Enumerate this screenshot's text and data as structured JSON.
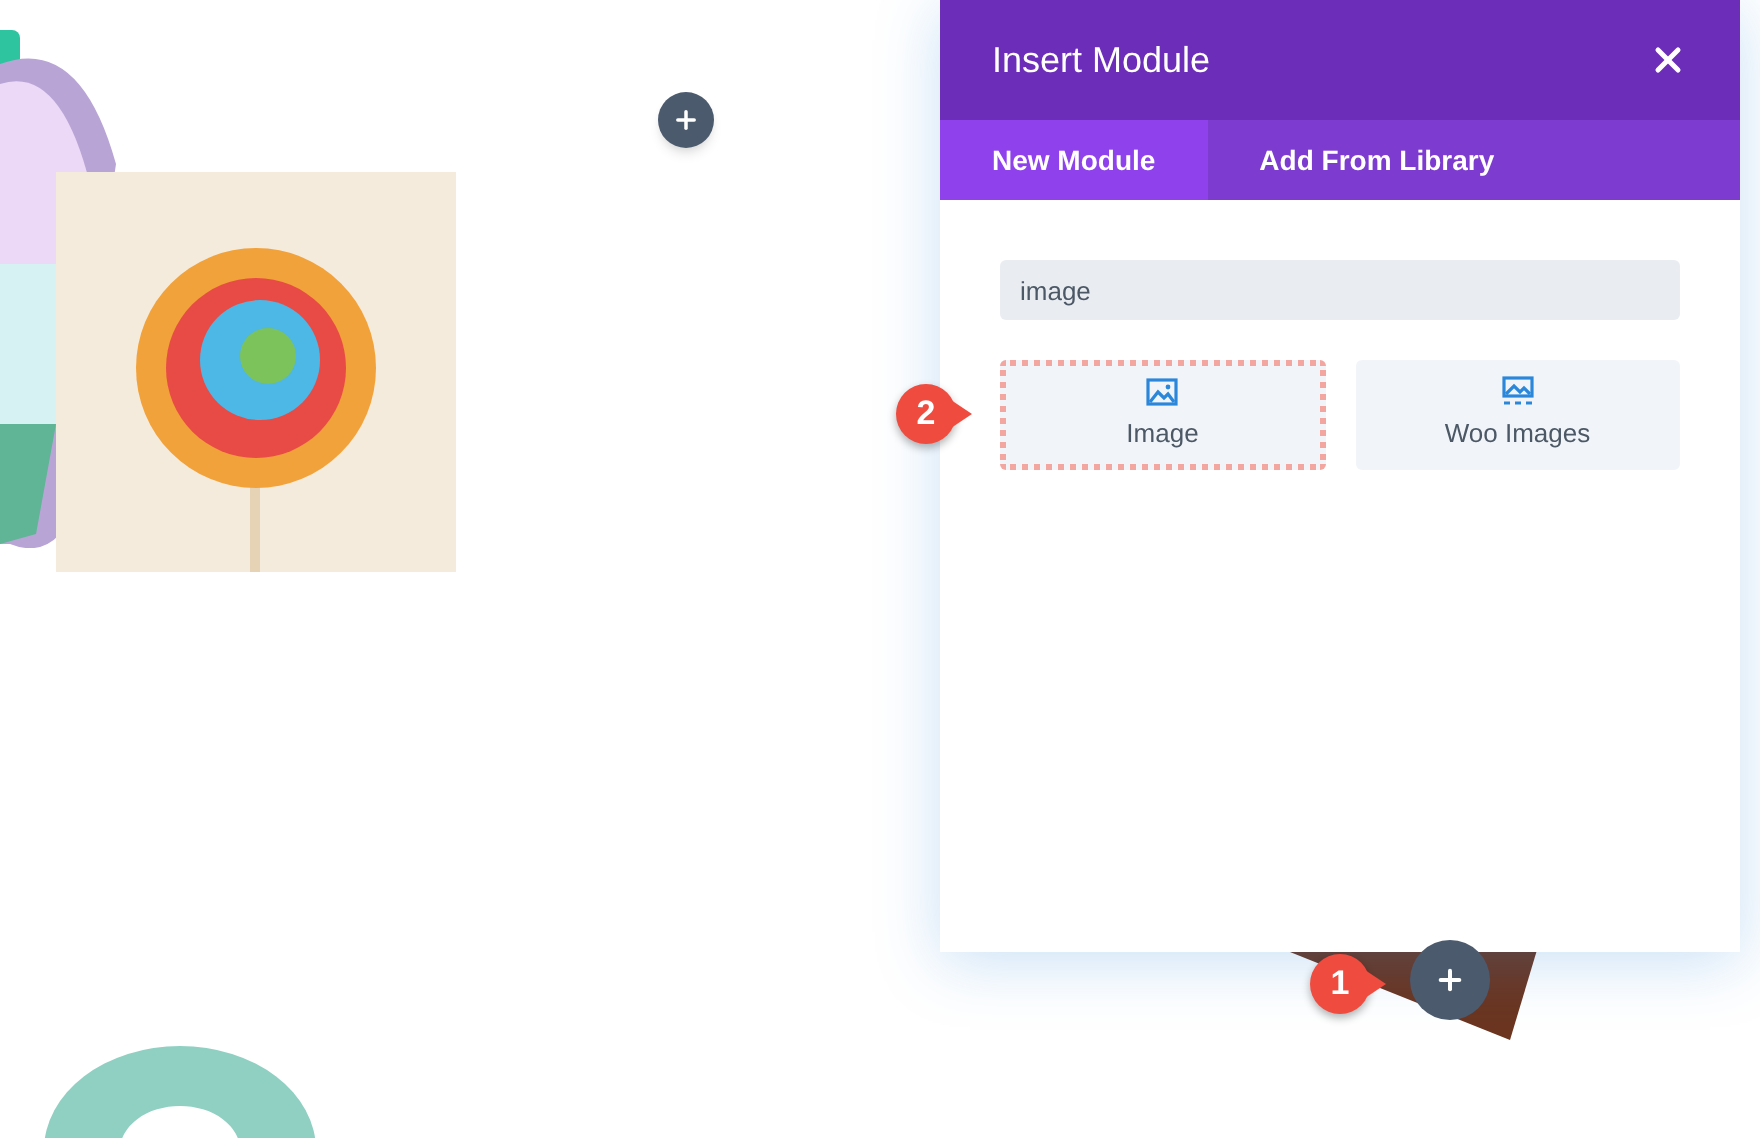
{
  "dialog": {
    "title": "Insert Module"
  },
  "tabs": [
    {
      "label": "New Module",
      "selected": true
    },
    {
      "label": "Add From Library",
      "selected": false
    }
  ],
  "search": {
    "value": "image"
  },
  "modules": [
    {
      "label": "Image",
      "kind": "image",
      "highlighted": true
    },
    {
      "label": "Woo Images",
      "kind": "gallery",
      "highlighted": false
    }
  ],
  "callouts": [
    {
      "label": "1",
      "kind": "add"
    },
    {
      "label": "2",
      "kind": "module"
    }
  ]
}
